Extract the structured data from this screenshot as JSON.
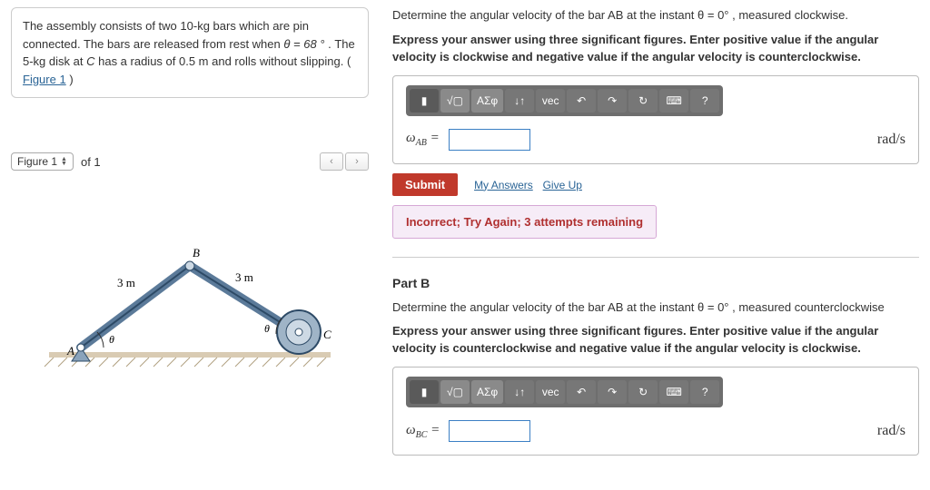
{
  "problem": {
    "text_1": "The assembly consists of two 10-kg bars which are pin connected. The bars are released from rest when ",
    "theta_eq": "θ = 68 °",
    "text_2": ". The 5-kg disk at ",
    "point": "C",
    "text_3": " has a radius of 0.5 m and rolls without slipping. (",
    "fig_link": "Figure 1",
    "text_4": ")"
  },
  "figure": {
    "label": "Figure 1",
    "of": "of 1",
    "len_left": "3 m",
    "len_right": "3 m",
    "pt_A": "A",
    "pt_B": "B",
    "pt_C": "C",
    "theta": "θ"
  },
  "partA": {
    "prompt": "Determine the angular velocity of the bar AB at the instant θ = 0° , measured clockwise.",
    "instr": "Express your answer using three significant figures. Enter positive value if the angular velocity is clockwise and negative value if the angular velocity is counterclockwise.",
    "var": "ω",
    "subscript": "AB",
    "eq": " =",
    "unit": "rad/s",
    "submit": "Submit",
    "my_answers": "My Answers",
    "give_up": "Give Up",
    "feedback": "Incorrect; Try Again; 3 attempts remaining"
  },
  "partB": {
    "label": "Part B",
    "prompt": "Determine the angular velocity of the bar AB at the instant θ = 0° , measured counterclockwise",
    "instr": "Express your answer using three significant figures. Enter positive value if the angular velocity is counterclockwise and negative value if the angular velocity is clockwise.",
    "var": "ω",
    "subscript": "BC",
    "eq": " =",
    "unit": "rad/s"
  },
  "toolbar": {
    "t1": "▮",
    "t2": "√▢",
    "t3": "ΑΣφ",
    "t4": "↓↑",
    "t5": "vec",
    "t6": "↶",
    "t7": "↷",
    "t8": "↻",
    "t9": "⌨",
    "t10": "?"
  }
}
